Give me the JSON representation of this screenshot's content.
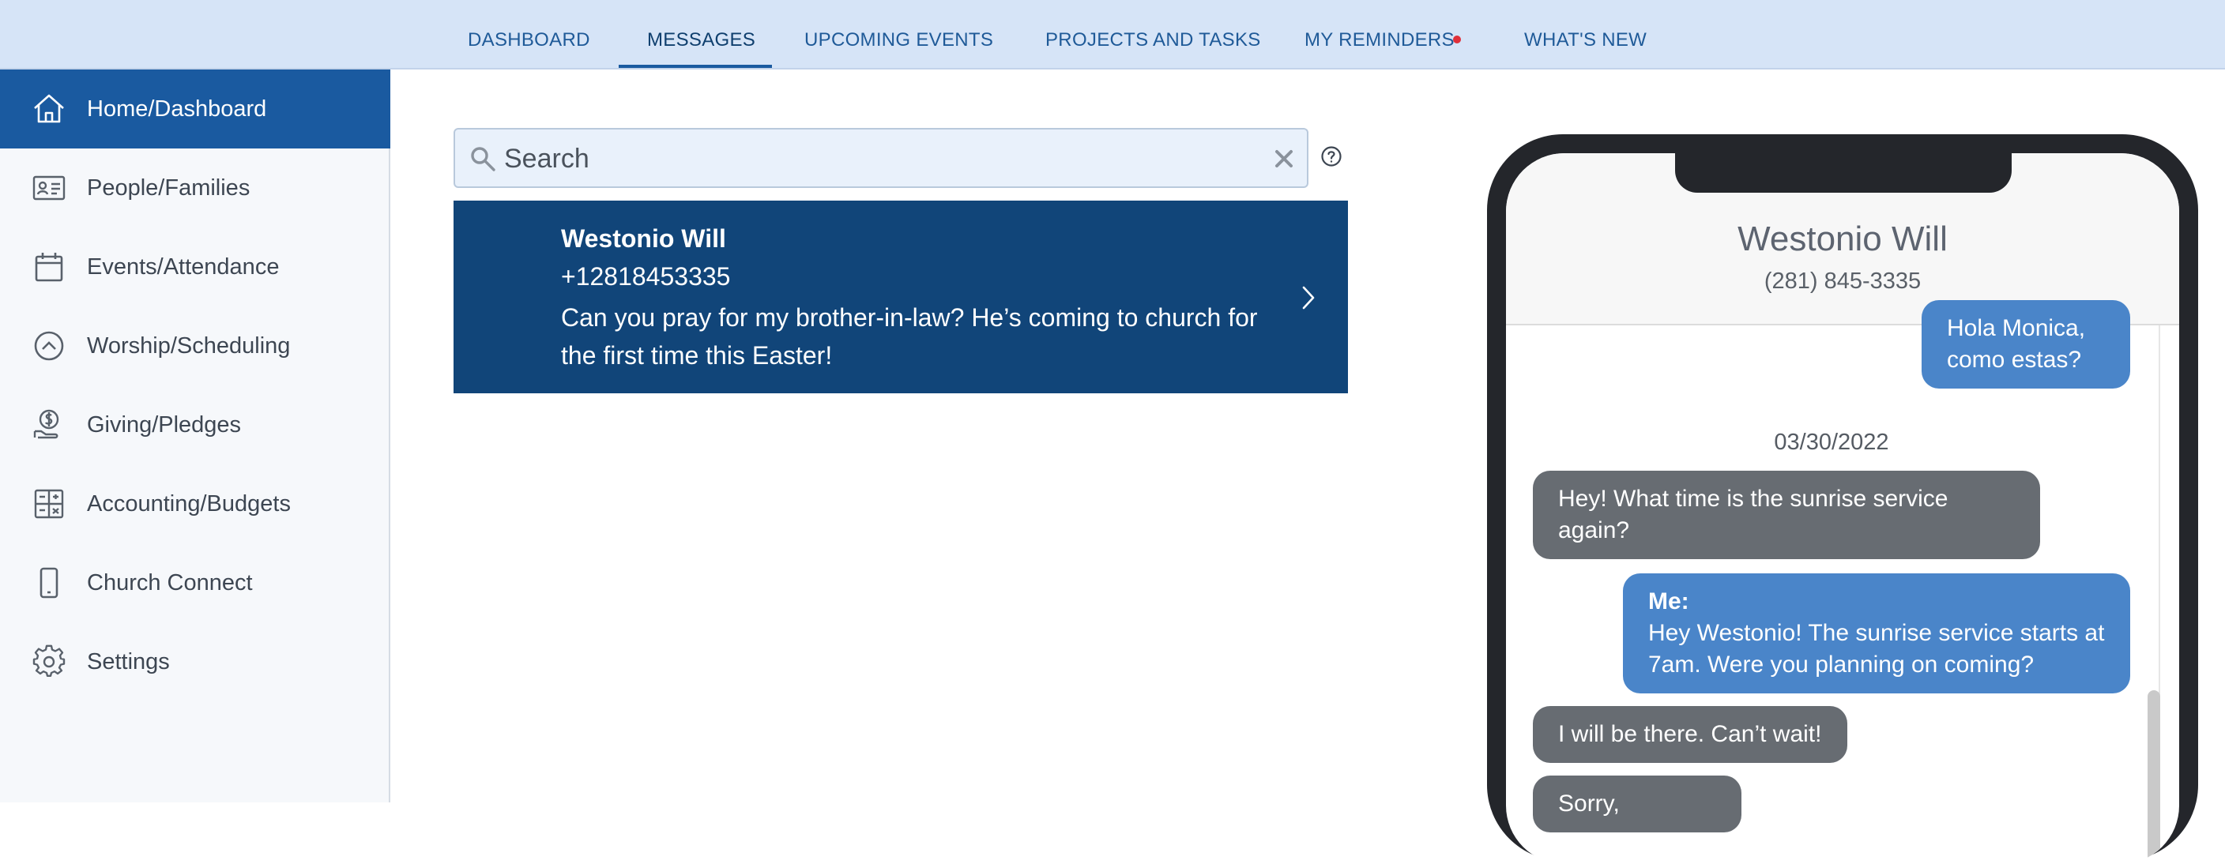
{
  "topnav": {
    "tabs": [
      {
        "label": "DASHBOARD"
      },
      {
        "label": "MESSAGES"
      },
      {
        "label": "UPCOMING EVENTS"
      },
      {
        "label": "PROJECTS AND TASKS"
      },
      {
        "label": "MY REMINDERS"
      },
      {
        "label": "WHAT'S NEW"
      }
    ],
    "active_tab": "MESSAGES"
  },
  "sidebar": {
    "items": [
      {
        "label": "Home/Dashboard",
        "icon": "home-icon"
      },
      {
        "label": "People/Families",
        "icon": "id-card-icon"
      },
      {
        "label": "Events/Attendance",
        "icon": "calendar-icon"
      },
      {
        "label": "Worship/Scheduling",
        "icon": "chevron-up-circle-icon"
      },
      {
        "label": "Giving/Pledges",
        "icon": "dollar-hand-icon"
      },
      {
        "label": "Accounting/Budgets",
        "icon": "grid-icon"
      },
      {
        "label": "Church Connect",
        "icon": "mobile-icon"
      },
      {
        "label": "Settings",
        "icon": "gear-icon"
      }
    ],
    "active": "Home/Dashboard"
  },
  "search": {
    "placeholder": "Search",
    "value": ""
  },
  "message_list": [
    {
      "name": "Westonio Will",
      "phone": "+12818453335",
      "preview": "Can you pray for my brother-in-law? He’s coming to church for the first time this Easter!"
    }
  ],
  "conversation": {
    "contact_name": "Westonio Will",
    "contact_phone": "(281) 845-3335",
    "date_label": "03/30/2022",
    "messages": [
      {
        "direction": "out",
        "text": "Hola Monica, como estas?"
      },
      {
        "direction": "in",
        "text": "Hey! What time is the sunrise service again?"
      },
      {
        "direction": "out",
        "sender": "Me:",
        "text": "Hey Westonio! The sunrise service starts at 7am. Were you planning on coming?"
      },
      {
        "direction": "in",
        "text": "I will be there. Can’t wait!"
      },
      {
        "direction": "in",
        "text": "Sorry,"
      }
    ]
  },
  "colors": {
    "nav_bg": "#d6e4f7",
    "sidebar_active": "#1a5aa0",
    "card_bg": "#114579",
    "bubble_out": "#4a85c9",
    "bubble_in": "#676c72",
    "reminder_dot": "#e0303a"
  }
}
